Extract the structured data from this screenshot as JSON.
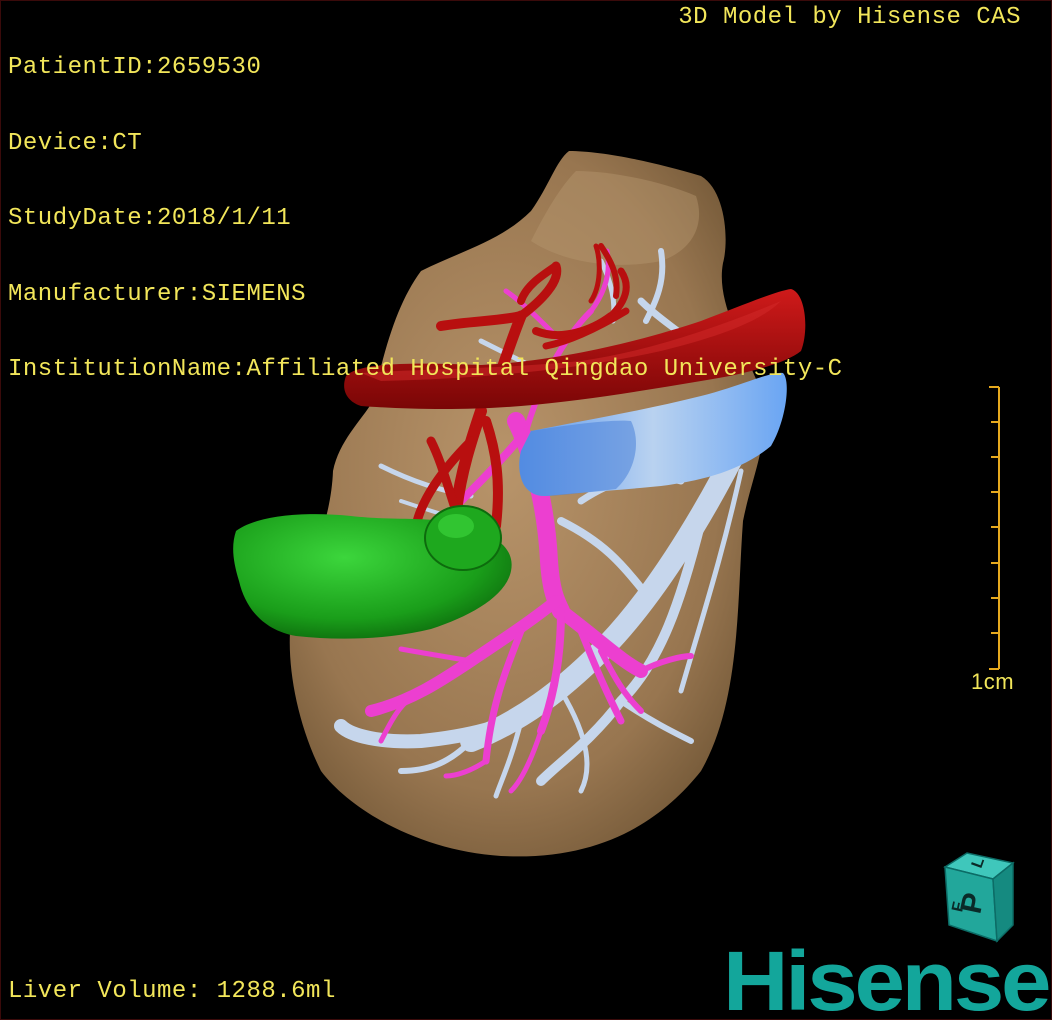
{
  "info": {
    "patient_id": "PatientID:2659530",
    "device": "Device:CT",
    "study_date": "StudyDate:2018/1/11",
    "manufacturer": "Manufacturer:SIEMENS",
    "institution": "InstitutionName:Affiliated Hospital Qingdao University-C"
  },
  "brand_caption": "3D Model by Hisense CAS",
  "liver_volume": "Liver Volume: 1288.6ml",
  "scale_bar": {
    "label": "1cm"
  },
  "orientation_cube": {
    "face_top": "L",
    "face_front": "P",
    "face_side": "F"
  },
  "logo_text": "Hisense",
  "colors": {
    "overlay_text": "#f2e65a",
    "liver": "#9c7b52",
    "artery": "#b30d0d",
    "portal_vein": "#ec3fd0",
    "hepatic_vein": "#c8d8ee",
    "ivc": "#6ea6f2",
    "tumor": "#22b322",
    "logo": "#13a69b"
  }
}
